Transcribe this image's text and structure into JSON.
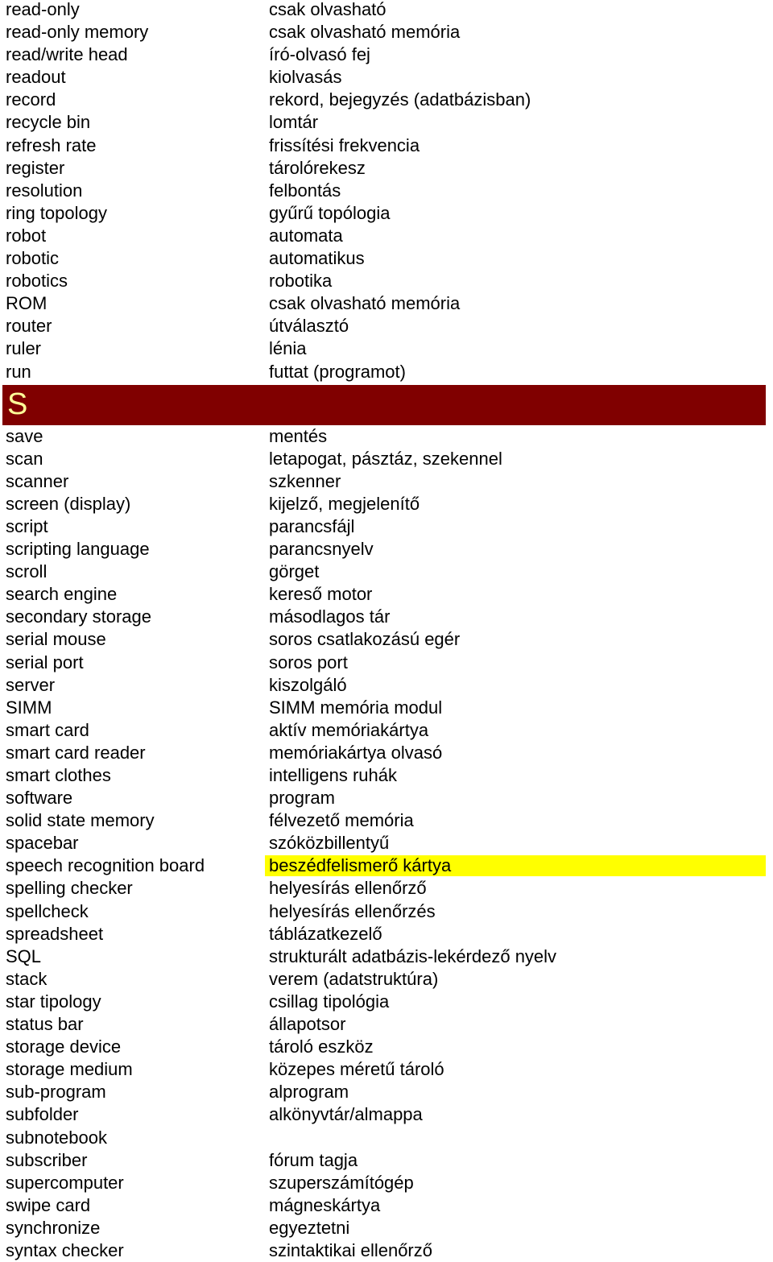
{
  "colors": {
    "section_header_bg": "#800000",
    "section_header_text": "#ffff99",
    "highlight": "#ffff00"
  },
  "group_r": [
    {
      "en": "read-only",
      "hu": "csak olvasható"
    },
    {
      "en": "read-only memory",
      "hu": "csak olvasható memória"
    },
    {
      "en": "read/write head",
      "hu": "író-olvasó fej"
    },
    {
      "en": "readout",
      "hu": "kiolvasás"
    },
    {
      "en": "record",
      "hu": "rekord, bejegyzés (adatbázisban)"
    },
    {
      "en": "recycle bin",
      "hu": "lomtár"
    },
    {
      "en": "refresh rate",
      "hu": "frissítési frekvencia"
    },
    {
      "en": "register",
      "hu": "tárolórekesz"
    },
    {
      "en": "resolution",
      "hu": "felbontás"
    },
    {
      "en": "ring topology",
      "hu": "gyűrű topólogia"
    },
    {
      "en": "robot",
      "hu": "automata"
    },
    {
      "en": "robotic",
      "hu": "automatikus"
    },
    {
      "en": "robotics",
      "hu": "robotika"
    },
    {
      "en": "ROM",
      "hu": "csak olvasható memória"
    },
    {
      "en": "router",
      "hu": "útválasztó"
    },
    {
      "en": "ruler",
      "hu": "lénia"
    },
    {
      "en": "run",
      "hu": "futtat (programot)"
    }
  ],
  "section_s": {
    "letter": "S"
  },
  "group_s": [
    {
      "en": "save",
      "hu": "mentés"
    },
    {
      "en": "scan",
      "hu": "letapogat, pásztáz, szekennel"
    },
    {
      "en": "scanner",
      "hu": "szkenner"
    },
    {
      "en": "screen (display)",
      "hu": "kijelző, megjelenítő"
    },
    {
      "en": "script",
      "hu": "parancsfájl"
    },
    {
      "en": "scripting language",
      "hu": "parancsnyelv"
    },
    {
      "en": "scroll",
      "hu": "görget"
    },
    {
      "en": "search engine",
      "hu": "kereső motor"
    },
    {
      "en": "secondary storage",
      "hu": "másodlagos tár"
    },
    {
      "en": "serial mouse",
      "hu": "soros csatlakozású egér"
    },
    {
      "en": "serial port",
      "hu": "soros port"
    },
    {
      "en": "server",
      "hu": "kiszolgáló"
    },
    {
      "en": "SIMM",
      "hu": "SIMM memória modul"
    },
    {
      "en": "smart card",
      "hu": "aktív memóriakártya"
    },
    {
      "en": "smart card reader",
      "hu": "memóriakártya olvasó"
    },
    {
      "en": "smart clothes",
      "hu": "intelligens ruhák"
    },
    {
      "en": "software",
      "hu": "program"
    },
    {
      "en": "solid state memory",
      "hu": "félvezető memória"
    },
    {
      "en": "spacebar",
      "hu": "szóközbillentyű"
    },
    {
      "en": "speech recognition board",
      "hu": "beszédfelismerő kártya",
      "highlighted": true
    },
    {
      "en": "spelling checker",
      "hu": "helyesírás ellenőrző"
    },
    {
      "en": "spellcheck",
      "hu": "helyesírás ellenőrzés"
    },
    {
      "en": "spreadsheet",
      "hu": "táblázatkezelő"
    },
    {
      "en": "SQL",
      "hu": "strukturált adatbázis-lekérdező nyelv"
    },
    {
      "en": "stack",
      "hu": "verem (adatstruktúra)"
    },
    {
      "en": "star tipology",
      "hu": "csillag tipológia"
    },
    {
      "en": "status bar",
      "hu": "állapotsor"
    },
    {
      "en": "storage device",
      "hu": "tároló eszköz"
    },
    {
      "en": "storage medium",
      "hu": "közepes méretű tároló"
    },
    {
      "en": "sub-program",
      "hu": "alprogram"
    },
    {
      "en": "subfolder",
      "hu": "alkönyvtár/almappa"
    },
    {
      "en": "subnotebook",
      "hu": ""
    },
    {
      "en": "subscriber",
      "hu": "fórum tagja"
    },
    {
      "en": "supercomputer",
      "hu": "szuperszámítógép"
    },
    {
      "en": "swipe card",
      "hu": "mágneskártya"
    },
    {
      "en": "synchronize",
      "hu": "egyeztetni"
    },
    {
      "en": "syntax checker",
      "hu": "szintaktikai ellenőrző"
    }
  ]
}
